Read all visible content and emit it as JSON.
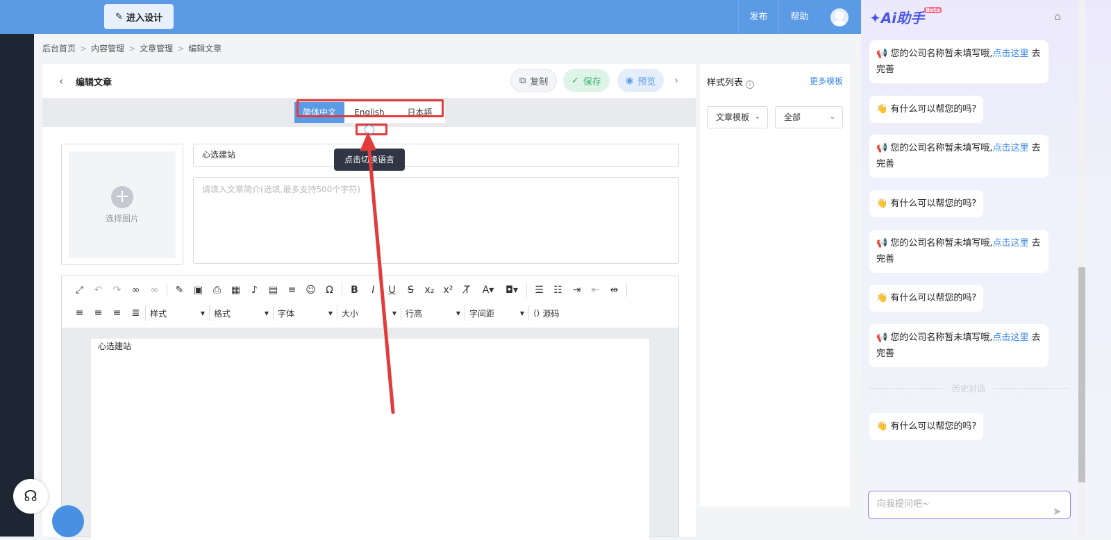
{
  "topbar": {
    "enter_design": "进入设计",
    "publish": "发布",
    "help": "帮助"
  },
  "breadcrumb": [
    "后台首页",
    "内容管理",
    "文章管理",
    "编辑文章"
  ],
  "breadcrumb_sep": ">",
  "editor_page": {
    "title": "编辑文章",
    "copy": "复制",
    "save": "保存",
    "preview": "预览",
    "languages": [
      "简体中文",
      "English",
      "日本語"
    ],
    "active_language": "简体中文",
    "tooltip": "点击切换语言",
    "select_image": "选择图片",
    "article_title": "心选建站",
    "summary_placeholder": "请填入文章简介(选填,最多支持500个字符)",
    "content_text": "心选建站",
    "toolbar_dropdowns": [
      "样式",
      "格式",
      "字体",
      "大小",
      "行高",
      "字间距"
    ],
    "source_label": "源码"
  },
  "style_panel": {
    "title": "样式列表",
    "more": "更多模板",
    "template_select": "文章模板",
    "filter_select": "全部"
  },
  "ai": {
    "logo": "Ai助手",
    "beta": "Beta",
    "messages": [
      {
        "text": "您的公司名称暂未填写哦,",
        "link": "点击这里",
        "tail": "去完善"
      },
      {
        "text": "有什么可以帮您的吗?"
      },
      {
        "text": "您的公司名称暂未填写哦,",
        "link": "点击这里",
        "tail": "去完善"
      },
      {
        "text": "有什么可以帮您的吗?"
      },
      {
        "text": "您的公司名称暂未填写哦,",
        "link": "点击这里",
        "tail": "去完善"
      },
      {
        "text": "有什么可以帮您的吗?"
      },
      {
        "text": "您的公司名称暂未填写哦,",
        "link": "点击这里",
        "tail": "去完善"
      }
    ],
    "history_label": "历史对话",
    "history_message": "有什么可以帮您的吗?",
    "input_placeholder": "向我提问吧~"
  },
  "colors": {
    "topbar": "#5b9be6",
    "annotation": "#e23b3b",
    "accent_link": "#3a86e8"
  }
}
